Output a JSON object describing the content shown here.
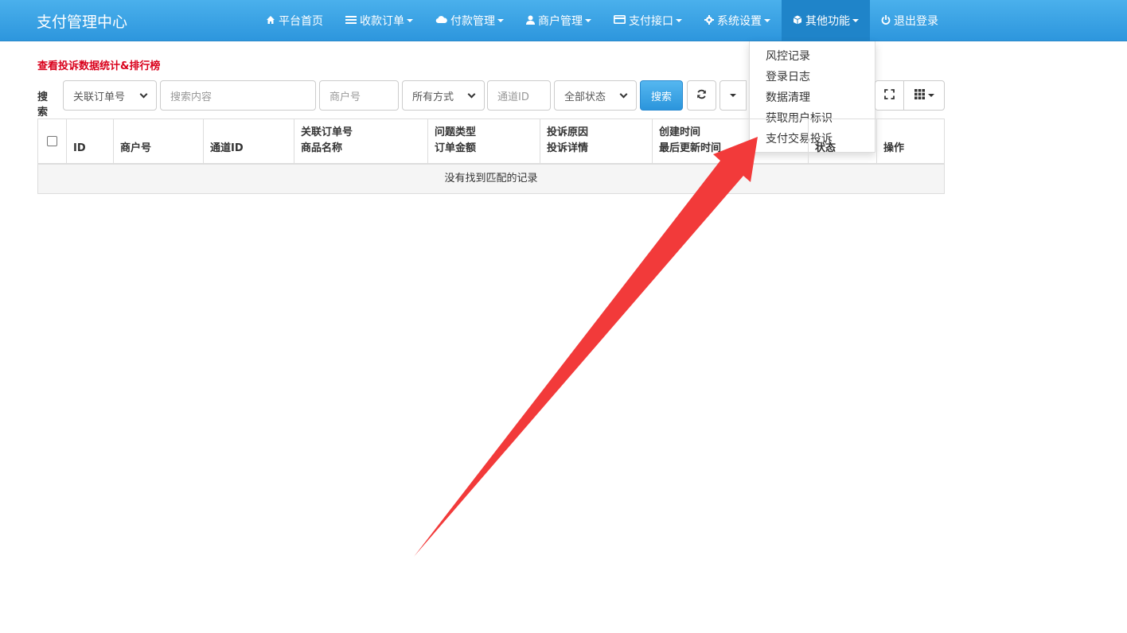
{
  "brand": "支付管理中心",
  "nav": [
    {
      "label": "平台首页",
      "icon": "home-icon",
      "caret": false
    },
    {
      "label": "收款订单",
      "icon": "list-icon",
      "caret": true
    },
    {
      "label": "付款管理",
      "icon": "cloud-icon",
      "caret": true
    },
    {
      "label": "商户管理",
      "icon": "user-icon",
      "caret": true
    },
    {
      "label": "支付接口",
      "icon": "credit-card-icon",
      "caret": true
    },
    {
      "label": "系统设置",
      "icon": "gear-icon",
      "caret": true
    },
    {
      "label": "其他功能",
      "icon": "cube-icon",
      "caret": true
    },
    {
      "label": "退出登录",
      "icon": "power-icon",
      "caret": false
    }
  ],
  "dropdown": [
    "风控记录",
    "登录日志",
    "数据清理",
    "获取用户标识",
    "支付交易投诉"
  ],
  "stats_link": "查看投诉数据统计&排行榜",
  "search": {
    "label": "搜索",
    "field_select": "关联订单号",
    "content_placeholder": "搜索内容",
    "merchant_placeholder": "商户号",
    "method_select": "所有方式",
    "channel_placeholder": "通道ID",
    "status_select": "全部状态",
    "search_button": "搜索"
  },
  "table": {
    "headers": [
      {
        "l1": "",
        "l2": "ID"
      },
      {
        "l1": "",
        "l2": "商户号"
      },
      {
        "l1": "",
        "l2": "通道ID"
      },
      {
        "l1": "关联订单号",
        "l2": "商品名称"
      },
      {
        "l1": "问题类型",
        "l2": "订单金额"
      },
      {
        "l1": "投诉原因",
        "l2": "投诉详情"
      },
      {
        "l1": "创建时间",
        "l2": "最后更新时间"
      },
      {
        "l1": "",
        "l2": "状态"
      },
      {
        "l1": "",
        "l2": "操作"
      }
    ],
    "empty_text": "没有找到匹配的记录"
  },
  "colors": {
    "nav_top": "#4ab0ec",
    "nav_bottom": "#2d96dd",
    "accent_red": "#d9001b",
    "arrow_red": "#f23a3a"
  }
}
